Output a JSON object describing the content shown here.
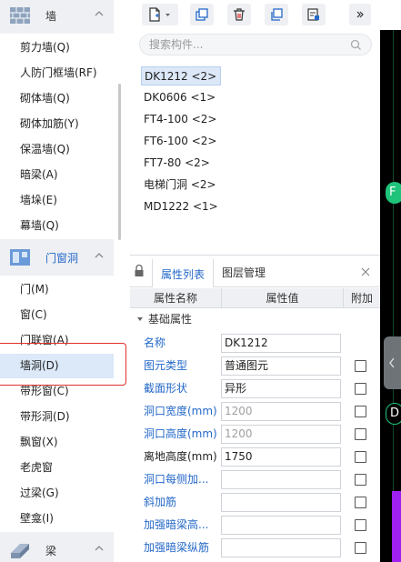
{
  "tree": {
    "categories": {
      "wall": "墙",
      "door_window": "门窗洞",
      "beam": "梁"
    },
    "wall_items": [
      "剪力墙(Q)",
      "人防门框墙(RF)",
      "砌体墙(Q)",
      "砌体加筋(Y)",
      "保温墙(Q)",
      "暗梁(A)",
      "墙垛(E)",
      "幕墙(Q)"
    ],
    "door_items": [
      "门(M)",
      "窗(C)",
      "门联窗(A)",
      "墙洞(D)",
      "带形窗(C)",
      "带形洞(D)",
      "飘窗(X)",
      "老虎窗",
      "过梁(G)",
      "壁龛(I)"
    ],
    "selected": "墙洞(D)"
  },
  "search": {
    "placeholder": "搜索构件..."
  },
  "components": [
    "DK1212 <2>",
    "DK0606 <1>",
    "FT4-100 <2>",
    "FT6-100 <2>",
    "FT7-80 <2>",
    "电梯门洞 <2>",
    "MD1222 <1>"
  ],
  "props_panel": {
    "tab_props": "属性列表",
    "tab_layers": "图层管理",
    "col_name": "属性名称",
    "col_value": "属性值",
    "col_extra": "附加",
    "group": "基础属性",
    "rows": [
      {
        "name": "名称",
        "value": "DK1212"
      },
      {
        "name": "图元类型",
        "value": "普通图元"
      },
      {
        "name": "截面形状",
        "value": "异形"
      },
      {
        "name": "洞口宽度(mm)",
        "value": "1200"
      },
      {
        "name": "洞口高度(mm)",
        "value": "1200"
      },
      {
        "name": "离地高度(mm)",
        "value": "1750"
      },
      {
        "name": "洞口每侧加...",
        "value": ""
      },
      {
        "name": "斜加筋",
        "value": ""
      },
      {
        "name": "加强暗梁高...",
        "value": ""
      },
      {
        "name": "加强暗梁纵筋",
        "value": ""
      }
    ]
  },
  "canvas": {
    "marker_f": "F",
    "marker_d": "D"
  },
  "colors": {
    "accent": "#2468c8",
    "selection": "#dbe9f8",
    "highlight_box": "#e0302a",
    "canvas_bg": "#000000",
    "marker_green": "#1fc47a"
  }
}
